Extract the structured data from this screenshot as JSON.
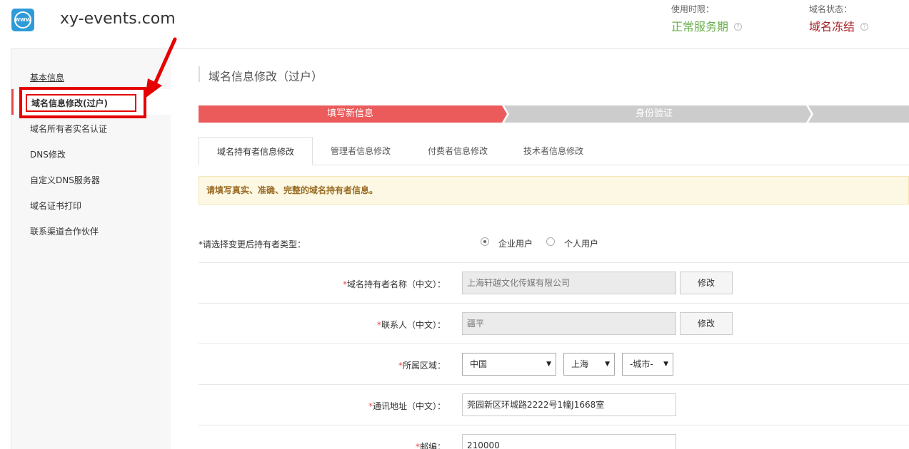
{
  "header": {
    "site_name": "xy-events.com",
    "logo_text": "WWW",
    "usage_label": "使用时限：",
    "usage_value": "正常服务期",
    "status_label": "域名状态：",
    "status_value": "域名冻结",
    "help_glyph": "?",
    "usage_color": "#6ab04c",
    "status_color": "#a8232a"
  },
  "sidebar": {
    "items": [
      {
        "label": "基本信息"
      },
      {
        "label": "域名信息修改(过户)"
      },
      {
        "label": "域名所有者实名认证"
      },
      {
        "label": "DNS修改"
      },
      {
        "label": "自定义DNS服务器"
      },
      {
        "label": "域名证书打印"
      },
      {
        "label": "联系渠道合作伙伴"
      }
    ]
  },
  "main": {
    "title": "域名信息修改（过户）",
    "steps": [
      {
        "label": "填写新信息",
        "active": true
      },
      {
        "label": "身份验证",
        "active": false
      }
    ],
    "tabs": [
      {
        "label": "域名持有者信息修改"
      },
      {
        "label": "管理者信息修改"
      },
      {
        "label": "付费者信息修改"
      },
      {
        "label": "技术者信息修改"
      }
    ],
    "notice": "请填写真实、准确、完整的域名持有者信息。",
    "form": {
      "type_label": "*请选择变更后持有者类型：",
      "type_options": [
        "企业用户",
        "个人用户"
      ],
      "name_label": "域名持有者名称（中文）：",
      "name_value": "上海轩越文化传媒有限公司",
      "contact_label": "联系人（中文）：",
      "contact_value": "疆平",
      "region_label": "所属区域：",
      "country": "中国",
      "province": "上海",
      "city": "-城市-",
      "address_label": "通讯地址（中文）：",
      "address_value": "莞园新区环城路2222号1幢J1668室",
      "zip_label": "邮编：",
      "zip_value": "210000",
      "modify_label": "修改",
      "required_mark": "*",
      "caret_glyph": "▼"
    }
  }
}
